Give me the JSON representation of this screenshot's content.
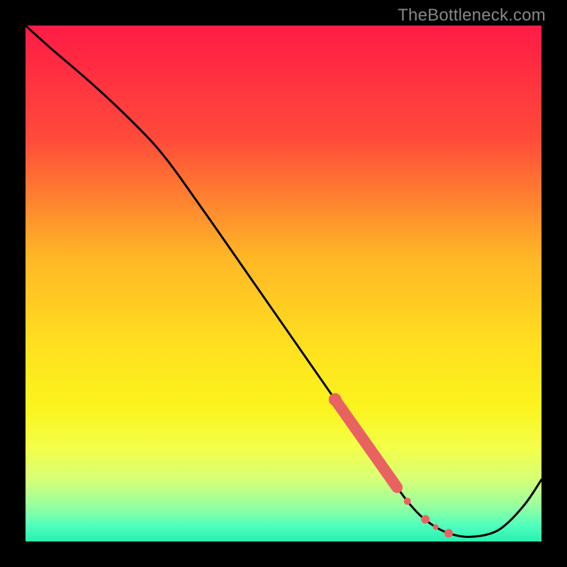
{
  "watermark": "TheBottleneck.com",
  "chart_data": {
    "type": "line",
    "title": "",
    "xlabel": "",
    "ylabel": "",
    "xlim": [
      0,
      100
    ],
    "ylim": [
      0,
      100
    ],
    "background_gradient_stops": [
      {
        "offset": 0.0,
        "color": "#ff1b45"
      },
      {
        "offset": 0.22,
        "color": "#ff4b3a"
      },
      {
        "offset": 0.45,
        "color": "#ffb726"
      },
      {
        "offset": 0.62,
        "color": "#ffe01f"
      },
      {
        "offset": 0.74,
        "color": "#fbf41e"
      },
      {
        "offset": 0.82,
        "color": "#f3ff4a"
      },
      {
        "offset": 0.88,
        "color": "#d6ff77"
      },
      {
        "offset": 0.93,
        "color": "#98ff9e"
      },
      {
        "offset": 0.97,
        "color": "#4fffbe"
      },
      {
        "offset": 1.0,
        "color": "#27efb0"
      }
    ],
    "series": [
      {
        "name": "curve",
        "x": [
          0.0,
          5.0,
          12.0,
          18.0,
          24.0,
          27.0,
          30.0,
          36.0,
          44.0,
          52.0,
          60.0,
          67.0,
          72.0,
          74.5,
          77.0,
          80.0,
          83.0,
          86.0,
          90.0,
          93.0,
          97.0,
          100.0
        ],
        "y": [
          100.0,
          95.5,
          89.5,
          84.0,
          78.0,
          74.5,
          70.5,
          62.0,
          50.5,
          39.0,
          27.5,
          17.5,
          10.5,
          7.2,
          4.6,
          2.5,
          1.3,
          0.9,
          1.5,
          3.2,
          7.5,
          12.0
        ]
      }
    ],
    "highlights": {
      "name": "red-segment",
      "color": "#e96262",
      "thick_segment": {
        "x0": 60.0,
        "y0": 27.5,
        "x1": 72.0,
        "y1": 10.5
      },
      "dots": [
        {
          "x": 74.0,
          "y": 7.8,
          "r": 5
        },
        {
          "x": 77.5,
          "y": 4.3,
          "r": 6
        },
        {
          "x": 79.5,
          "y": 2.8,
          "r": 4
        },
        {
          "x": 82.0,
          "y": 1.6,
          "r": 6
        }
      ]
    }
  }
}
